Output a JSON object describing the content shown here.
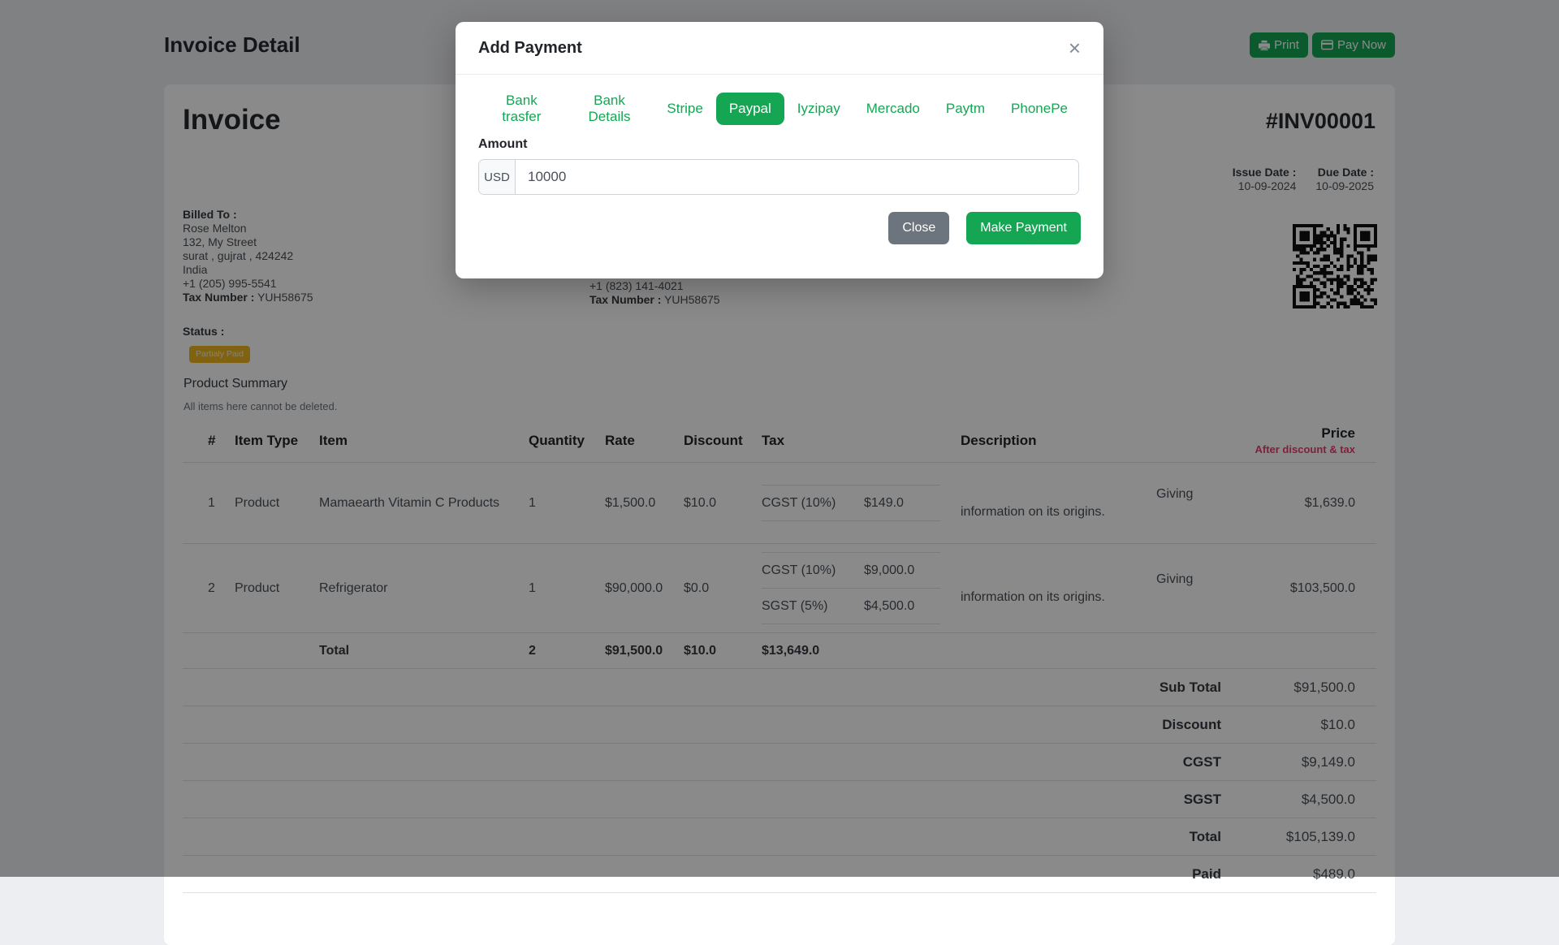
{
  "page": {
    "title": "Invoice Detail",
    "print_label": "Print",
    "pay_now_label": "Pay Now",
    "invoice_title": "Invoice",
    "invoice_number": "#INV00001",
    "billed_to": {
      "label": "Billed To :",
      "lines": [
        "Rose Melton",
        "132, My Street",
        "surat , gujrat , 424242",
        "India",
        "+1 (205) 995-5541"
      ],
      "tax_label": "Tax Number :",
      "tax_value": "YUH58675"
    },
    "shipped_to": {
      "phone": "+1 (823) 141-4021",
      "tax_label": "Tax Number :",
      "tax_value": "YUH58675"
    },
    "issue_date": {
      "label": "Issue Date :",
      "value": "10-09-2024"
    },
    "due_date": {
      "label": "Due Date :",
      "value": "10-09-2025"
    },
    "status": {
      "label": "Status :",
      "badge": "Partialy Paid"
    },
    "product_summary": {
      "title": "Product Summary",
      "subtitle": "All items here cannot be deleted."
    },
    "table": {
      "headers": {
        "num": "#",
        "type": "Item Type",
        "item": "Item",
        "qty": "Quantity",
        "rate": "Rate",
        "discount": "Discount",
        "tax": "Tax",
        "description": "Description",
        "price": "Price",
        "price_note": "After discount & tax"
      },
      "rows": [
        {
          "num": "1",
          "item_type": "Product",
          "item": "Mamaearth Vitamin C Products",
          "qty": "1",
          "rate": "$1,500.0",
          "discount": "$10.0",
          "taxes": [
            {
              "name": "CGST (10%)",
              "amount": "$149.0"
            }
          ],
          "description": "Giving information on its origins.",
          "price": "$1,639.0"
        },
        {
          "num": "2",
          "item_type": "Product",
          "item": "Refrigerator",
          "qty": "1",
          "rate": "$90,000.0",
          "discount": "$0.0",
          "taxes": [
            {
              "name": "CGST (10%)",
              "amount": "$9,000.0"
            },
            {
              "name": "SGST (5%)",
              "amount": "$4,500.0"
            }
          ],
          "description": "Giving information on its origins.",
          "price": "$103,500.0"
        }
      ],
      "total_row": {
        "label": "Total",
        "qty": "2",
        "rate": "$91,500.0",
        "discount": "$10.0",
        "tax": "$13,649.0"
      },
      "summary": [
        {
          "label": "Sub Total",
          "value": "$91,500.0"
        },
        {
          "label": "Discount",
          "value": "$10.0"
        },
        {
          "label": "CGST",
          "value": "$9,149.0"
        },
        {
          "label": "SGST",
          "value": "$4,500.0"
        },
        {
          "label": "Total",
          "value": "$105,139.0"
        },
        {
          "label": "Paid",
          "value": "$489.0"
        }
      ]
    }
  },
  "modal": {
    "title": "Add Payment",
    "close_icon": "×",
    "tabs": [
      "Bank trasfer",
      "Bank Details",
      "Stripe",
      "Paypal",
      "Iyzipay",
      "Mercado",
      "Paytm",
      "PhonePe"
    ],
    "active_tab": "Paypal",
    "amount": {
      "label": "Amount",
      "currency": "USD",
      "value": "10000"
    },
    "close_label": "Close",
    "submit_label": "Make Payment"
  },
  "colors": {
    "accent_green": "#15a653",
    "muted_button_gray": "#6c757d",
    "status_badge_amber": "#edb51e",
    "price_note_pink": "#f03a6e"
  }
}
